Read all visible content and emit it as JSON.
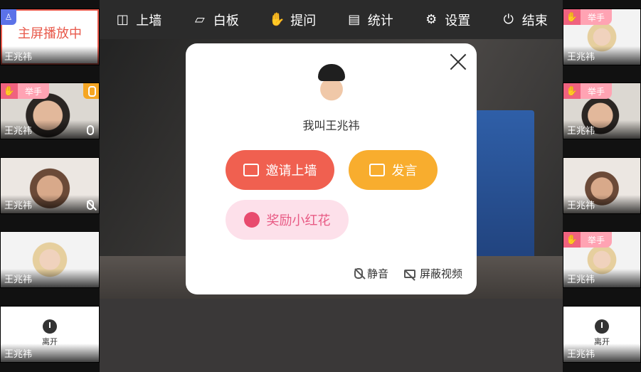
{
  "toolbar": {
    "items": [
      {
        "label": "上墙",
        "icon": "wall-display-icon"
      },
      {
        "label": "白板",
        "icon": "whiteboard-book-icon"
      },
      {
        "label": "提问",
        "icon": "hand-raise-icon"
      },
      {
        "label": "统计",
        "icon": "bar-chart-icon"
      },
      {
        "label": "设置",
        "icon": "gear-icon"
      },
      {
        "label": "结束",
        "icon": "power-icon"
      }
    ]
  },
  "left_column": {
    "main_screen_label": "主屏播放中",
    "tiles": [
      {
        "name": "王兆祎"
      },
      {
        "name": "王兆祎",
        "hand_label": "举手"
      },
      {
        "name": "王兆祎"
      },
      {
        "name": "王兆祎"
      },
      {
        "name": "王兆祎",
        "status": "离开"
      }
    ]
  },
  "right_column": {
    "tiles": [
      {
        "name": "王兆祎",
        "hand_label": "举手"
      },
      {
        "name": "王兆祎",
        "hand_label": "举手"
      },
      {
        "name": "王兆祎"
      },
      {
        "name": "王兆祎",
        "hand_label": "举手"
      },
      {
        "name": "王兆祎",
        "status": "离开"
      }
    ]
  },
  "dialog": {
    "username": "我叫王兆祎",
    "invite_label": "邀请上墙",
    "speak_label": "发言",
    "reward_label": "奖励小红花",
    "mute_label": "静音",
    "block_video_label": "屏蔽视频"
  },
  "colors": {
    "accent_red": "#f06050",
    "accent_orange": "#f8ad2e",
    "accent_pink": "#fde0ea",
    "hand_badge": "#f0627f"
  }
}
